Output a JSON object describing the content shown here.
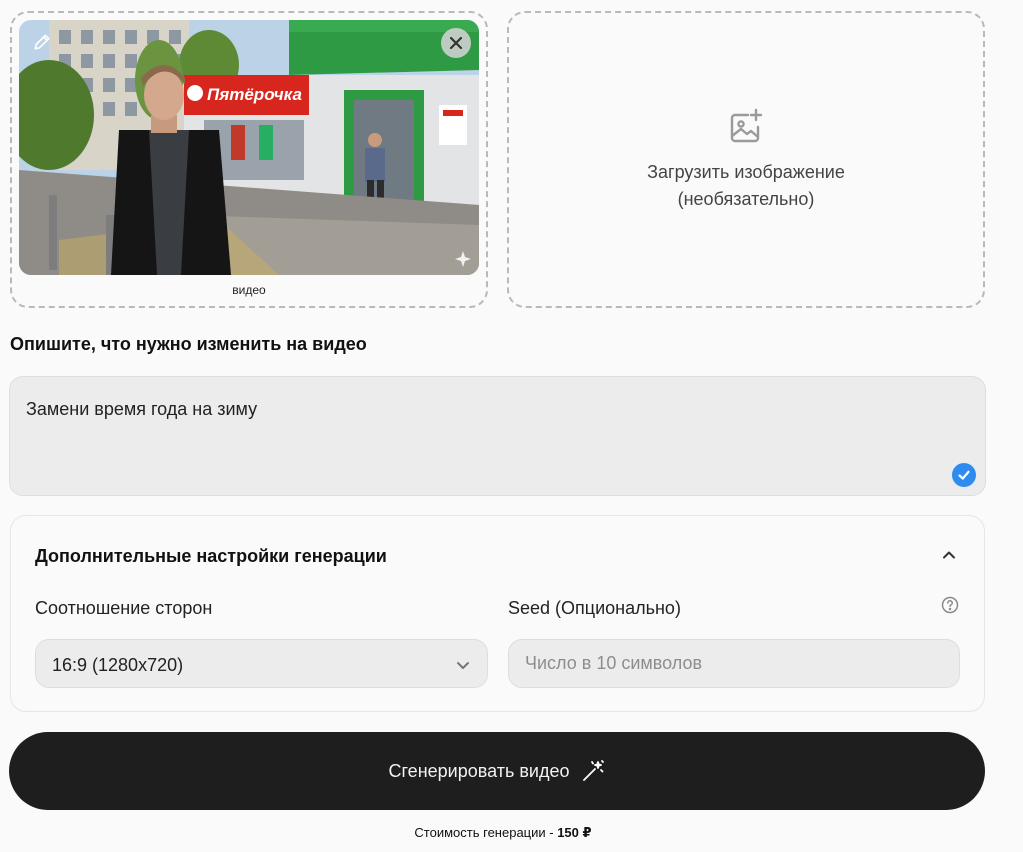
{
  "video_card": {
    "caption": "видео",
    "storefront_sign": "Пятёрочка"
  },
  "image_upload": {
    "text": "Загрузить изображение\n(необязательно)"
  },
  "prompt": {
    "label": "Опишите, что нужно изменить на видео",
    "value": "Замени время года на зиму"
  },
  "settings": {
    "title": "Дополнительные настройки генерации",
    "aspect": {
      "label": "Соотношение сторон",
      "selected": "16:9 (1280x720)"
    },
    "seed": {
      "label": "Seed (Опционально)",
      "placeholder": "Число в 10 символов",
      "value": ""
    }
  },
  "generate": {
    "label": "Сгенерировать видео"
  },
  "cost": {
    "prefix": "Стоимость генерации - ",
    "amount": "150 ₽"
  },
  "colors": {
    "accent_blue": "#2f8bf0",
    "button_dark": "#1e1e1e",
    "store_red": "#d7261e",
    "store_green": "#2f9a44"
  },
  "icons": {
    "edit": "pencil-icon",
    "close": "close-icon",
    "sparkle": "sparkle-icon",
    "upload": "image-plus-icon",
    "check": "check-circle-icon",
    "collapse": "chevron-up-icon",
    "help": "help-circle-icon",
    "select": "chevron-down-icon",
    "generate": "magic-wand-icon"
  }
}
